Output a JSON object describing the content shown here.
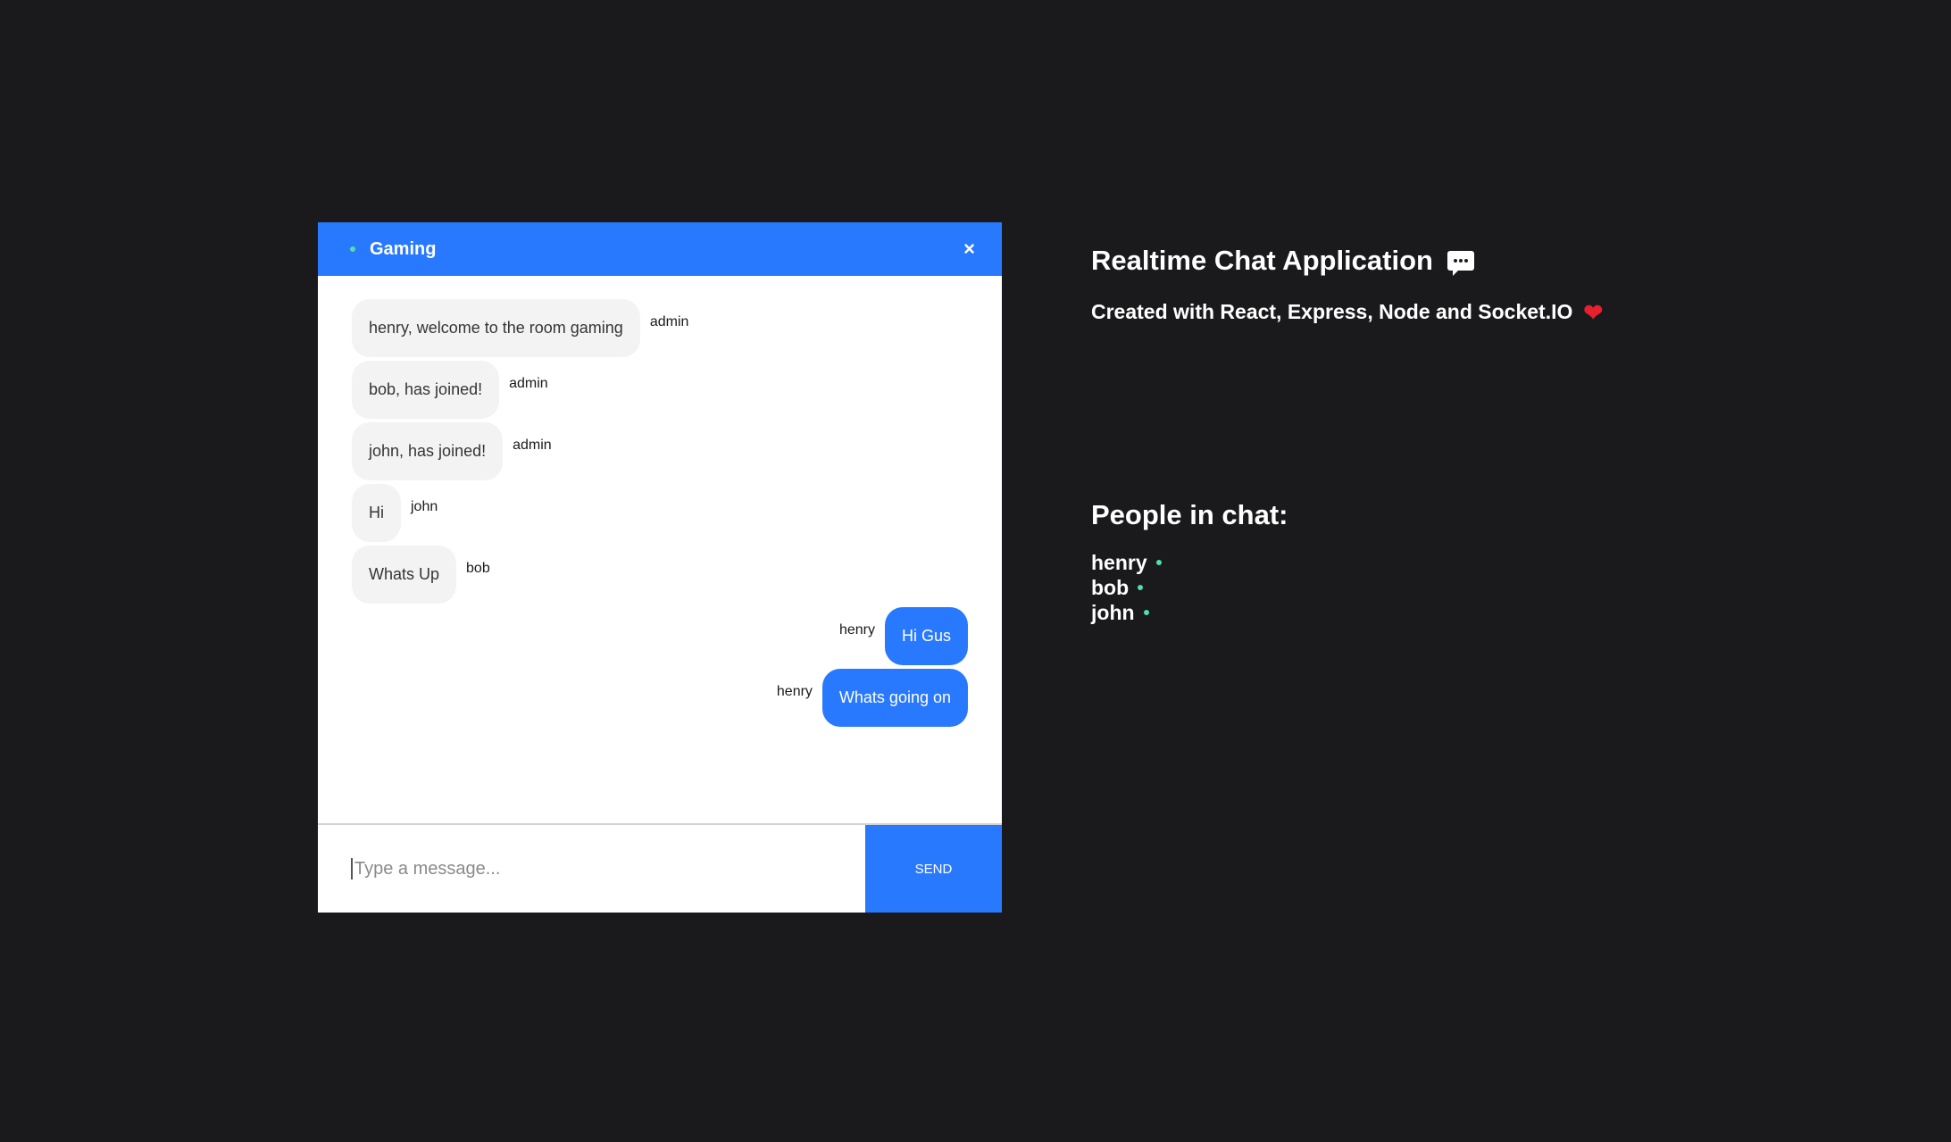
{
  "chat": {
    "room_name": "Gaming",
    "close_label": "×",
    "messages": [
      {
        "text": "henry, welcome to the room gaming",
        "sender": "admin",
        "own": false
      },
      {
        "text": "bob, has joined!",
        "sender": "admin",
        "own": false
      },
      {
        "text": "john, has joined!",
        "sender": "admin",
        "own": false
      },
      {
        "text": "Hi",
        "sender": "john",
        "own": false
      },
      {
        "text": "Whats Up",
        "sender": "bob",
        "own": false
      },
      {
        "text": "Hi Gus",
        "sender": "henry",
        "own": true
      },
      {
        "text": "Whats going on",
        "sender": "henry",
        "own": true
      }
    ],
    "input_placeholder": "Type a message...",
    "input_value": "",
    "send_label": "SEND"
  },
  "info": {
    "title": "Realtime Chat Application",
    "subtitle": "Created with React, Express, Node and Socket.IO",
    "people_heading": "People in chat:",
    "people": [
      "henry",
      "bob",
      "john"
    ]
  },
  "colors": {
    "background": "#1a1a1d",
    "accent": "#2979ff",
    "online": "#4fe0a8",
    "heart": "#e8202e"
  },
  "icons": {
    "online": "online-dot-icon",
    "close": "close-icon",
    "title_icon": "speech-bubble-icon",
    "subtitle_icon": "heart-icon"
  }
}
